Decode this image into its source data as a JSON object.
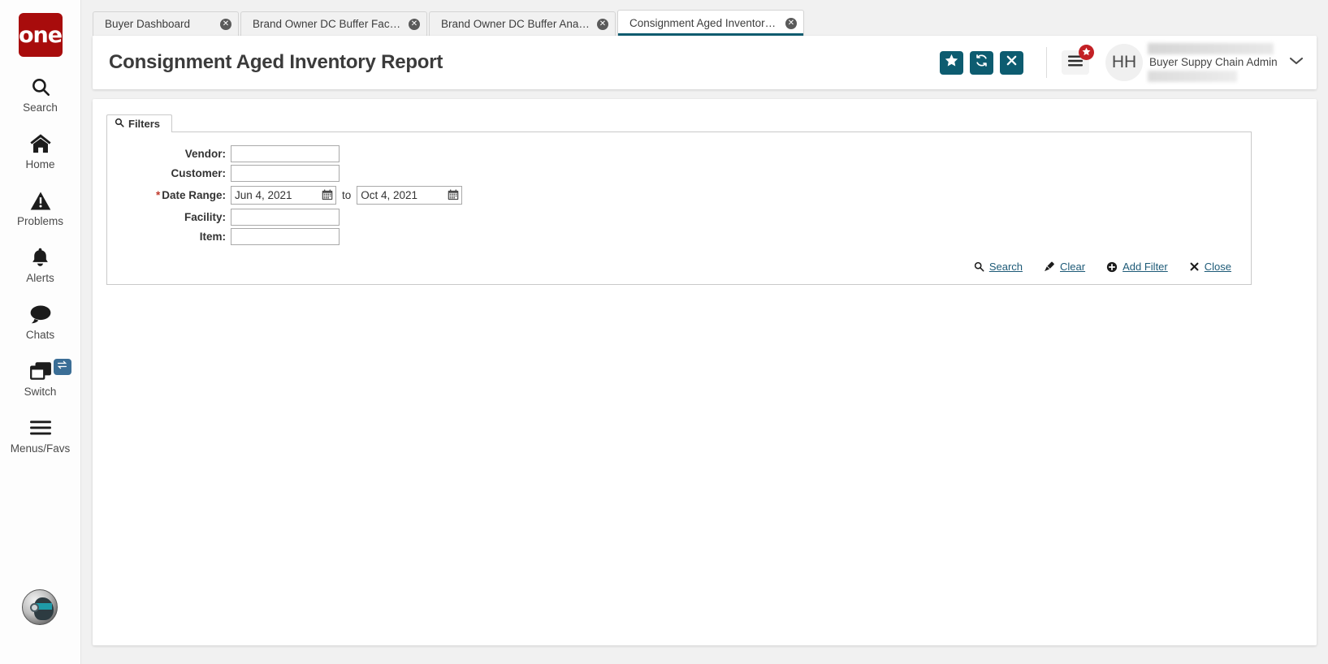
{
  "brand": {
    "logo_text": "one",
    "logo_color": "#a80c0c"
  },
  "theme": {
    "accent_teal": "#0d5c70",
    "link_blue": "#1d5a77",
    "badge_red": "#c32025",
    "switch_badge_blue": "#3b6e96"
  },
  "sidebar": {
    "items": [
      {
        "label": "Search",
        "icon": "search-icon"
      },
      {
        "label": "Home",
        "icon": "home-icon"
      },
      {
        "label": "Problems",
        "icon": "warning-triangle-icon"
      },
      {
        "label": "Alerts",
        "icon": "bell-icon"
      },
      {
        "label": "Chats",
        "icon": "chat-bubble-icon"
      },
      {
        "label": "Switch",
        "icon": "windows-stack-icon",
        "badge_icon": "swap-arrows-icon"
      },
      {
        "label": "Menus/Favs",
        "icon": "hamburger-icon"
      }
    ],
    "assistant_icon": "ai-assistant-orb-icon"
  },
  "tabs": [
    {
      "label": "Buyer Dashboard",
      "active": false,
      "close_icon": "close-circle-icon"
    },
    {
      "label": "Brand Owner DC Buffer Fact Rep...",
      "active": false,
      "close_icon": "close-circle-icon"
    },
    {
      "label": "Brand Owner DC Buffer Analytic...",
      "active": false,
      "close_icon": "close-circle-icon"
    },
    {
      "label": "Consignment Aged Inventory Re...",
      "active": true,
      "close_icon": "close-circle-icon"
    }
  ],
  "header": {
    "title": "Consignment Aged Inventory Report",
    "actions": [
      {
        "name": "favorite-button",
        "icon": "star-icon"
      },
      {
        "name": "refresh-button",
        "icon": "refresh-icon"
      },
      {
        "name": "close-report-button",
        "icon": "x-icon"
      }
    ],
    "menus_favs_icon": "hamburger-icon",
    "menus_favs_badge_icon": "star-icon",
    "user": {
      "initials": "HH",
      "role": "Buyer Suppy Chain Admin",
      "caret_icon": "chevron-down-icon"
    }
  },
  "filters": {
    "tab_label": "Filters",
    "tab_icon": "search-icon",
    "fields": [
      {
        "label": "Vendor:",
        "value": "",
        "placeholder": "",
        "required": false,
        "type": "text",
        "name": "vendor-field"
      },
      {
        "label": "Customer:",
        "value": "",
        "placeholder": "",
        "required": false,
        "type": "text",
        "name": "customer-field"
      },
      {
        "label": "Date Range:",
        "required": true,
        "type": "daterange",
        "name": "date-range-field",
        "from_value": "Jun 4, 2021",
        "to_value": "Oct 4, 2021",
        "separator": "to",
        "calendar_icon": "calendar-icon"
      },
      {
        "label": "Facility:",
        "value": "",
        "placeholder": "",
        "required": false,
        "type": "text",
        "name": "facility-field"
      },
      {
        "label": "Item:",
        "value": "",
        "placeholder": "",
        "required": false,
        "type": "text",
        "name": "item-field"
      }
    ],
    "actions": [
      {
        "label": "Search",
        "icon": "search-icon",
        "name": "filter-search-link"
      },
      {
        "label": "Clear",
        "icon": "eraser-icon",
        "name": "filter-clear-link"
      },
      {
        "label": "Add Filter",
        "icon": "plus-circle-icon",
        "name": "filter-add-link"
      },
      {
        "label": "Close",
        "icon": "x-icon",
        "name": "filter-close-link"
      }
    ]
  }
}
